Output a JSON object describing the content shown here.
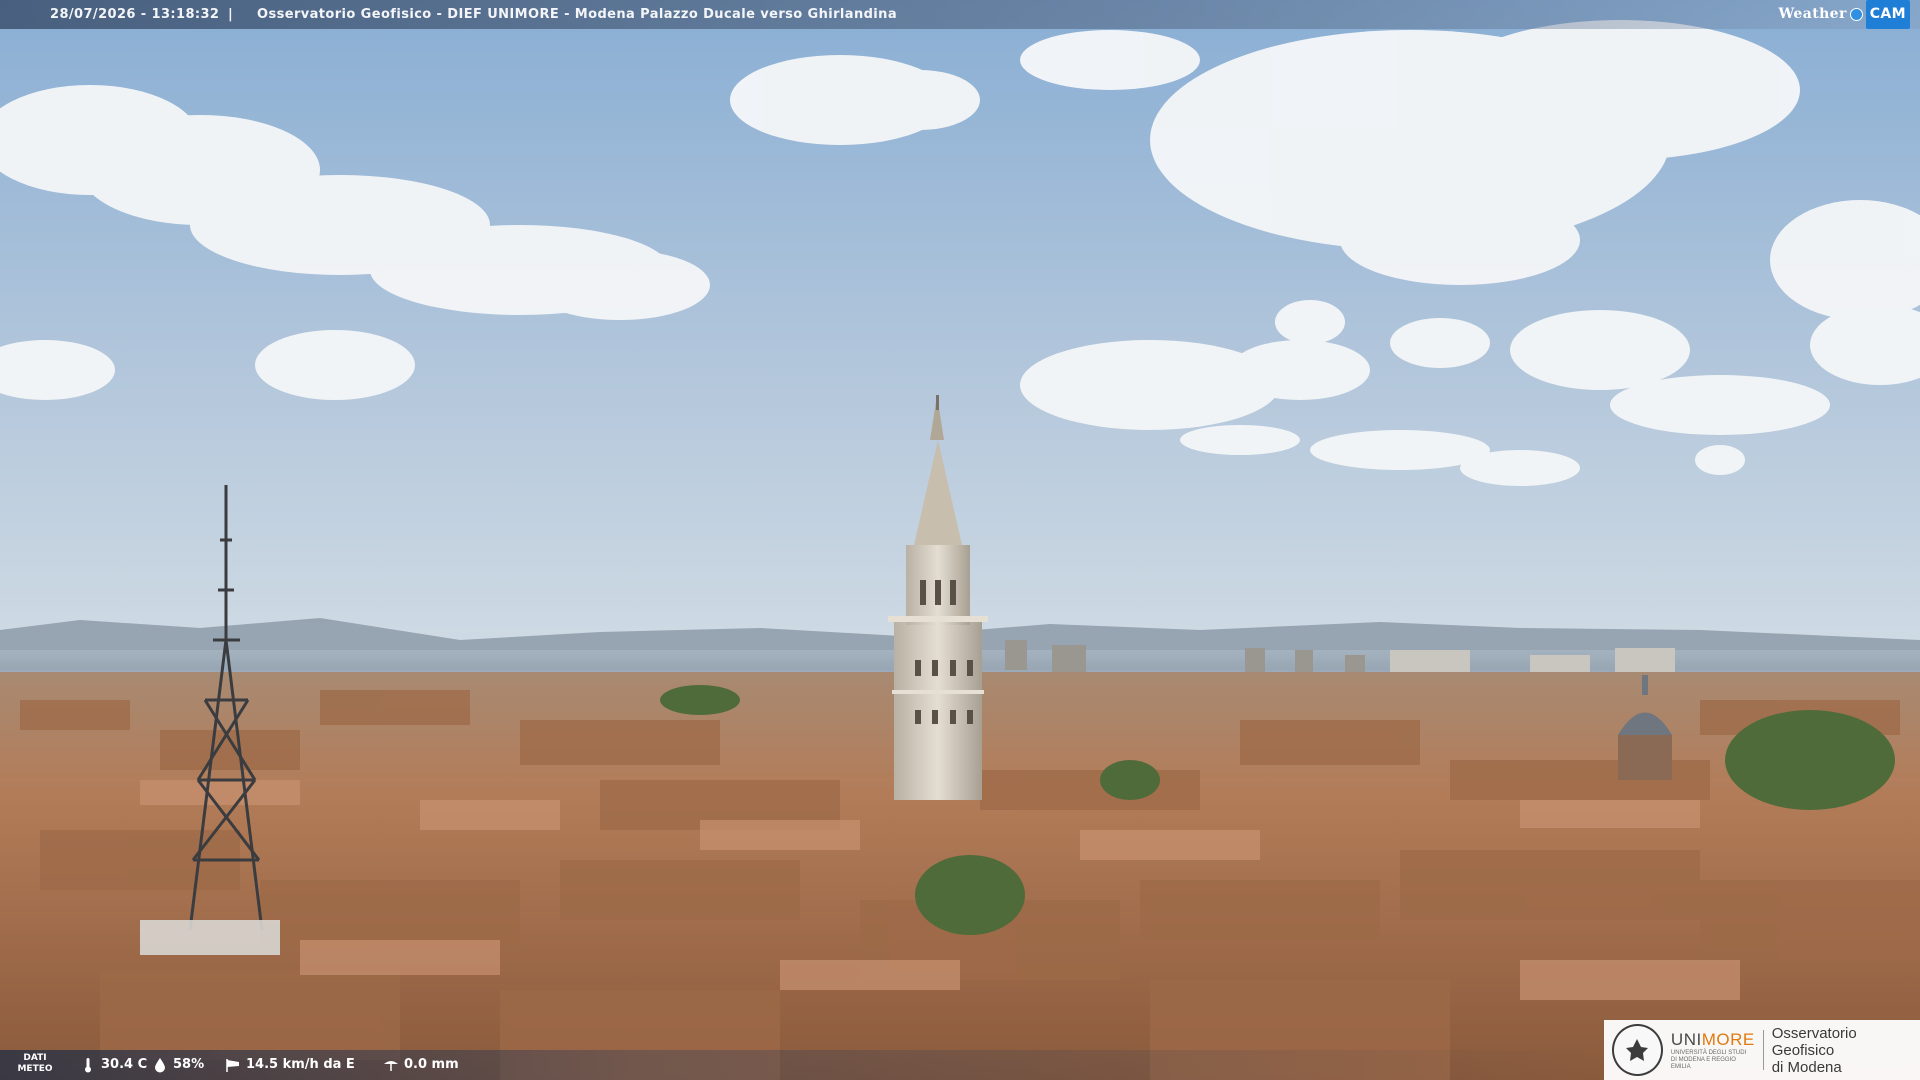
{
  "header": {
    "timestamp": "28/07/2026 - 13:18:32",
    "separator": "|",
    "title": "Osservatorio Geofisico - DIEF UNIMORE - Modena Palazzo Ducale verso Ghirlandina",
    "brand_weather": "Weather",
    "brand_cam": "CAM"
  },
  "weather": {
    "label_line1": "DATI",
    "label_line2": "METEO",
    "temperature": "30.4 C",
    "humidity": "58%",
    "wind": "14.5 km/h da E",
    "rain": "0.0 mm",
    "icons": [
      "thermometer-icon",
      "humidity-drop-icon",
      "wind-sock-icon",
      "rain-gauge-icon"
    ]
  },
  "logo": {
    "uni_name_gray": "UNI",
    "uni_name_accent": "MORE",
    "uni_subtitle": "UNIVERSITÀ DEGLI STUDI DI MODENA E REGGIO EMILIA",
    "observatory_line1": "Osservatorio Geofisico",
    "observatory_line2": "di Modena"
  },
  "colors": {
    "sky_top": "#8aaed3",
    "sky_horizon": "#c9d6e2",
    "roof": "#b07a54",
    "tower": "#d8d2c6",
    "accent": "#e07a10"
  }
}
